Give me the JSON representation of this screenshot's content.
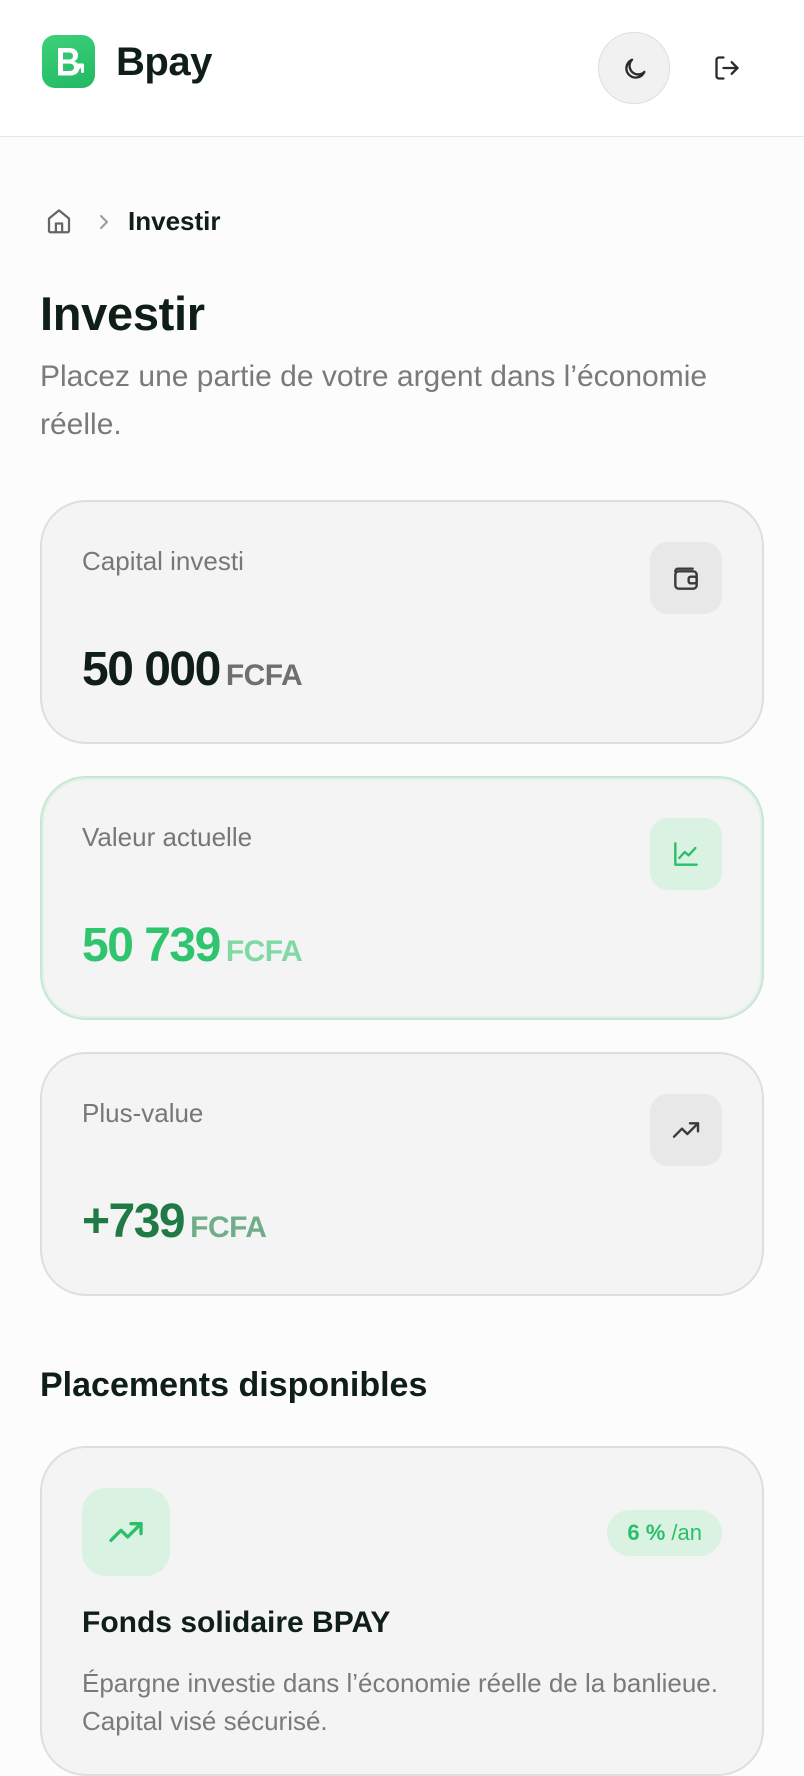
{
  "header": {
    "brand_name": "Bpay",
    "logo_icon": "bpay-logo-icon",
    "theme_toggle_icon": "moon-icon",
    "logout_icon": "logout-icon"
  },
  "breadcrumb": {
    "home_icon": "home-icon",
    "separator_icon": "chevron-right-icon",
    "current": "Investir"
  },
  "page": {
    "title": "Investir",
    "subtitle": "Placez une partie de votre argent dans l’économie réelle."
  },
  "stats": [
    {
      "label": "Capital investi",
      "value": "50 000",
      "unit": "FCFA",
      "icon": "wallet-icon",
      "value_color": "#0f1f17",
      "unit_color": "#6f6f6f"
    },
    {
      "label": "Valeur actuelle",
      "value": "50 739",
      "unit": "FCFA",
      "icon": "line-chart-icon",
      "value_color": "#2fc56e",
      "unit_color": "#7fd9a3"
    },
    {
      "label": "Plus-value",
      "value": "+739",
      "unit": "FCFA",
      "icon": "trending-up-icon",
      "value_color": "#1f7a45",
      "unit_color": "#6fae89"
    }
  ],
  "placements": {
    "section_title": "Placements disponibles",
    "items": [
      {
        "name": "Fonds solidaire BPAY",
        "description": "Épargne investie dans l’économie réelle de la banlieue. Capital visé sécurisé.",
        "rate_value": "6 %",
        "rate_period": "/an",
        "icon": "trending-up-icon"
      }
    ]
  },
  "colors": {
    "accent": "#2cbf6a",
    "accent_soft": "#d9f2e2",
    "text_dark": "#0f1f17",
    "text_muted": "#7a7a7a",
    "card_bg": "#f4f4f4"
  }
}
